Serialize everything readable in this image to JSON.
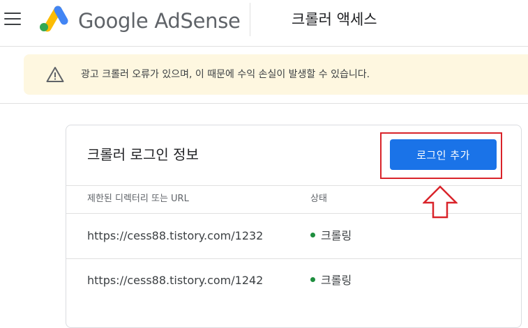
{
  "header": {
    "brand": "Google AdSense",
    "page_title": "크롤러 액세스"
  },
  "banner": {
    "message": "광고 크롤러 오류가 있으며, 이 때문에 수익 손실이 발생할 수 있습니다."
  },
  "card": {
    "title": "크롤러 로그인 정보",
    "add_login_label": "로그인 추가",
    "columns": {
      "path": "제한된 디렉터리 또는 URL",
      "status": "상태"
    },
    "rows": [
      {
        "url": "https://cess88.tistory.com/1232",
        "status": "크롤링"
      },
      {
        "url": "https://cess88.tistory.com/1242",
        "status": "크롤링"
      }
    ]
  },
  "colors": {
    "primary": "#1a73e8",
    "banner_bg": "#fef7e0",
    "status_ok": "#1e8e3e",
    "annotation": "#d9232a"
  },
  "icons": [
    "menu-icon",
    "adsense-logo",
    "warning-icon",
    "status-dot-icon",
    "arrow-up-icon"
  ]
}
